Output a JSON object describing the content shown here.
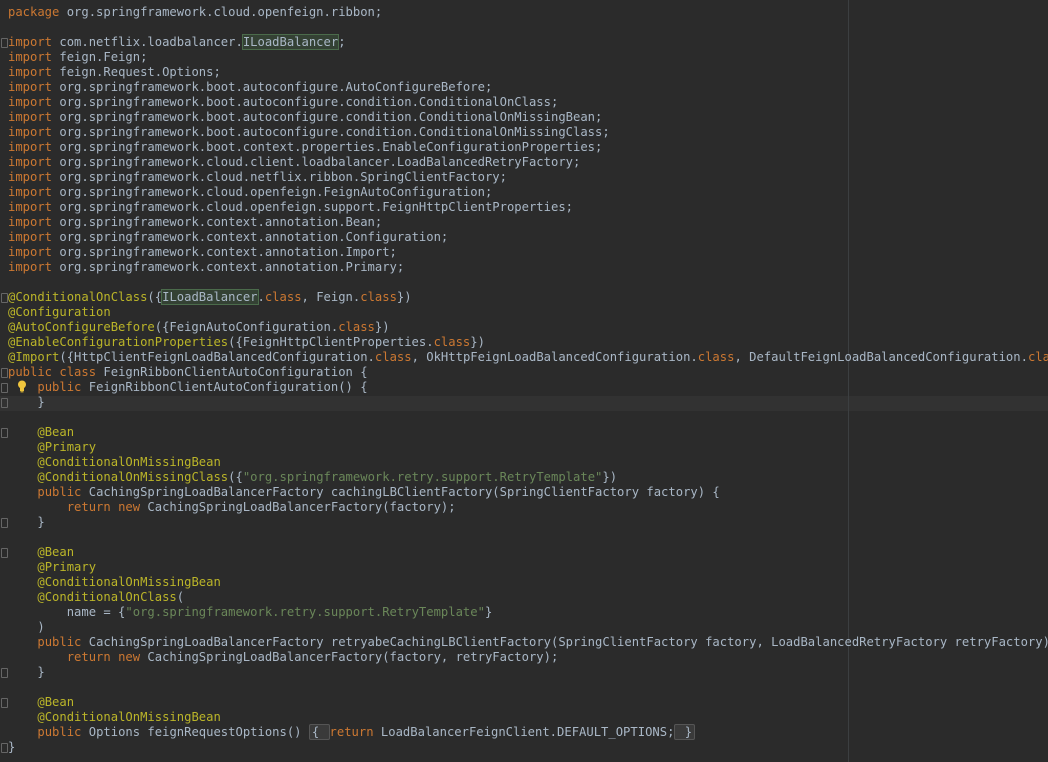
{
  "editor": {
    "lines": [
      [
        {
          "c": "kw",
          "t": "package "
        },
        {
          "t": "org.springframework.cloud.openfeign.ribbon;"
        }
      ],
      [],
      [
        {
          "c": "kw",
          "t": "import "
        },
        {
          "t": "com.netflix.loadbalancer."
        },
        {
          "c": "hl",
          "t": "ILoadBalancer"
        },
        {
          "t": ";"
        }
      ],
      [
        {
          "c": "kw",
          "t": "import "
        },
        {
          "t": "feign.Feign;"
        }
      ],
      [
        {
          "c": "kw",
          "t": "import "
        },
        {
          "t": "feign.Request.Options;"
        }
      ],
      [
        {
          "c": "kw",
          "t": "import "
        },
        {
          "t": "org.springframework.boot.autoconfigure.AutoConfigureBefore;"
        }
      ],
      [
        {
          "c": "kw",
          "t": "import "
        },
        {
          "t": "org.springframework.boot.autoconfigure.condition.ConditionalOnClass;"
        }
      ],
      [
        {
          "c": "kw",
          "t": "import "
        },
        {
          "t": "org.springframework.boot.autoconfigure.condition.ConditionalOnMissingBean;"
        }
      ],
      [
        {
          "c": "kw",
          "t": "import "
        },
        {
          "t": "org.springframework.boot.autoconfigure.condition.ConditionalOnMissingClass;"
        }
      ],
      [
        {
          "c": "kw",
          "t": "import "
        },
        {
          "t": "org.springframework.boot.context.properties.EnableConfigurationProperties;"
        }
      ],
      [
        {
          "c": "kw",
          "t": "import "
        },
        {
          "t": "org.springframework.cloud.client.loadbalancer.LoadBalancedRetryFactory;"
        }
      ],
      [
        {
          "c": "kw",
          "t": "import "
        },
        {
          "t": "org.springframework.cloud.netflix.ribbon.SpringClientFactory;"
        }
      ],
      [
        {
          "c": "kw",
          "t": "import "
        },
        {
          "t": "org.springframework.cloud.openfeign.FeignAutoConfiguration;"
        }
      ],
      [
        {
          "c": "kw",
          "t": "import "
        },
        {
          "t": "org.springframework.cloud.openfeign.support.FeignHttpClientProperties;"
        }
      ],
      [
        {
          "c": "kw",
          "t": "import "
        },
        {
          "t": "org.springframework.context.annotation.Bean;"
        }
      ],
      [
        {
          "c": "kw",
          "t": "import "
        },
        {
          "t": "org.springframework.context.annotation.Configuration;"
        }
      ],
      [
        {
          "c": "kw",
          "t": "import "
        },
        {
          "t": "org.springframework.context.annotation.Import;"
        }
      ],
      [
        {
          "c": "kw",
          "t": "import "
        },
        {
          "t": "org.springframework.context.annotation.Primary;"
        }
      ],
      [],
      [
        {
          "c": "ann",
          "t": "@ConditionalOnClass"
        },
        {
          "t": "({"
        },
        {
          "c": "hl",
          "t": "ILoadBalancer"
        },
        {
          "t": "."
        },
        {
          "c": "kw",
          "t": "class"
        },
        {
          "t": ", Feign."
        },
        {
          "c": "kw",
          "t": "class"
        },
        {
          "t": "})"
        }
      ],
      [
        {
          "c": "ann",
          "t": "@Configuration"
        }
      ],
      [
        {
          "c": "ann",
          "t": "@AutoConfigureBefore"
        },
        {
          "t": "({FeignAutoConfiguration."
        },
        {
          "c": "kw",
          "t": "class"
        },
        {
          "t": "})"
        }
      ],
      [
        {
          "c": "ann",
          "t": "@EnableConfigurationProperties"
        },
        {
          "t": "({FeignHttpClientProperties."
        },
        {
          "c": "kw",
          "t": "class"
        },
        {
          "t": "})"
        }
      ],
      [
        {
          "c": "ann",
          "t": "@Import"
        },
        {
          "t": "({HttpClientFeignLoadBalancedConfiguration."
        },
        {
          "c": "kw",
          "t": "class"
        },
        {
          "t": ", OkHttpFeignLoadBalancedConfiguration."
        },
        {
          "c": "kw",
          "t": "class"
        },
        {
          "t": ", DefaultFeignLoadBalancedConfiguration."
        },
        {
          "c": "kw",
          "t": "class"
        },
        {
          "t": "})"
        }
      ],
      [
        {
          "c": "kw",
          "t": "public class "
        },
        {
          "t": "FeignRibbonClientAutoConfiguration {"
        }
      ],
      [
        {
          "t": "    "
        },
        {
          "c": "kw",
          "t": "public "
        },
        {
          "t": "FeignRibbonClientAutoConfiguration() {"
        }
      ],
      [
        {
          "t": "    }"
        }
      ],
      [],
      [
        {
          "t": "    "
        },
        {
          "c": "ann",
          "t": "@Bean"
        }
      ],
      [
        {
          "t": "    "
        },
        {
          "c": "ann",
          "t": "@Primary"
        }
      ],
      [
        {
          "t": "    "
        },
        {
          "c": "ann",
          "t": "@ConditionalOnMissingBean"
        }
      ],
      [
        {
          "t": "    "
        },
        {
          "c": "ann",
          "t": "@ConditionalOnMissingClass"
        },
        {
          "t": "({"
        },
        {
          "c": "str",
          "t": "\"org.springframework.retry.support.RetryTemplate\""
        },
        {
          "t": "})"
        }
      ],
      [
        {
          "t": "    "
        },
        {
          "c": "kw",
          "t": "public "
        },
        {
          "t": "CachingSpringLoadBalancerFactory cachingLBClientFactory(SpringClientFactory factory) {"
        }
      ],
      [
        {
          "t": "        "
        },
        {
          "c": "kw",
          "t": "return new "
        },
        {
          "t": "CachingSpringLoadBalancerFactory(factory);"
        }
      ],
      [
        {
          "t": "    }"
        }
      ],
      [],
      [
        {
          "t": "    "
        },
        {
          "c": "ann",
          "t": "@Bean"
        }
      ],
      [
        {
          "t": "    "
        },
        {
          "c": "ann",
          "t": "@Primary"
        }
      ],
      [
        {
          "t": "    "
        },
        {
          "c": "ann",
          "t": "@ConditionalOnMissingBean"
        }
      ],
      [
        {
          "t": "    "
        },
        {
          "c": "ann",
          "t": "@ConditionalOnClass"
        },
        {
          "t": "("
        }
      ],
      [
        {
          "t": "        name = {"
        },
        {
          "c": "str",
          "t": "\"org.springframework.retry.support.RetryTemplate\""
        },
        {
          "t": "}"
        }
      ],
      [
        {
          "t": "    )"
        }
      ],
      [
        {
          "t": "    "
        },
        {
          "c": "kw",
          "t": "public "
        },
        {
          "t": "CachingSpringLoadBalancerFactory retryabeCachingLBClientFactory(SpringClientFactory factory, LoadBalancedRetryFactory retryFactory) {"
        }
      ],
      [
        {
          "t": "        "
        },
        {
          "c": "kw",
          "t": "return new "
        },
        {
          "t": "CachingSpringLoadBalancerFactory(factory, retryFactory);"
        }
      ],
      [
        {
          "t": "    }"
        }
      ],
      [],
      [
        {
          "t": "    "
        },
        {
          "c": "ann",
          "t": "@Bean"
        }
      ],
      [
        {
          "t": "    "
        },
        {
          "c": "ann",
          "t": "@ConditionalOnMissingBean"
        }
      ],
      [
        {
          "t": "    "
        },
        {
          "c": "kw",
          "t": "public "
        },
        {
          "t": "Options feignRequestOptions() "
        },
        {
          "c": "folded",
          "t": "{ "
        },
        {
          "c": "kw",
          "t": "return "
        },
        {
          "t": "LoadBalancerFeignClient.DEFAULT_OPTIONS;"
        },
        {
          "c": "folded",
          "t": " }"
        }
      ],
      [
        {
          "t": "}"
        }
      ]
    ],
    "intention_icon": "lightbulb-icon",
    "fold_markers": [
      2,
      19,
      24,
      25,
      26,
      28,
      34,
      36,
      44,
      46,
      49
    ],
    "colors": {
      "background": "#2b2b2b",
      "keyword": "#cc7832",
      "annotation": "#bbb529",
      "string": "#6a8759",
      "text": "#a9b7c6"
    }
  }
}
